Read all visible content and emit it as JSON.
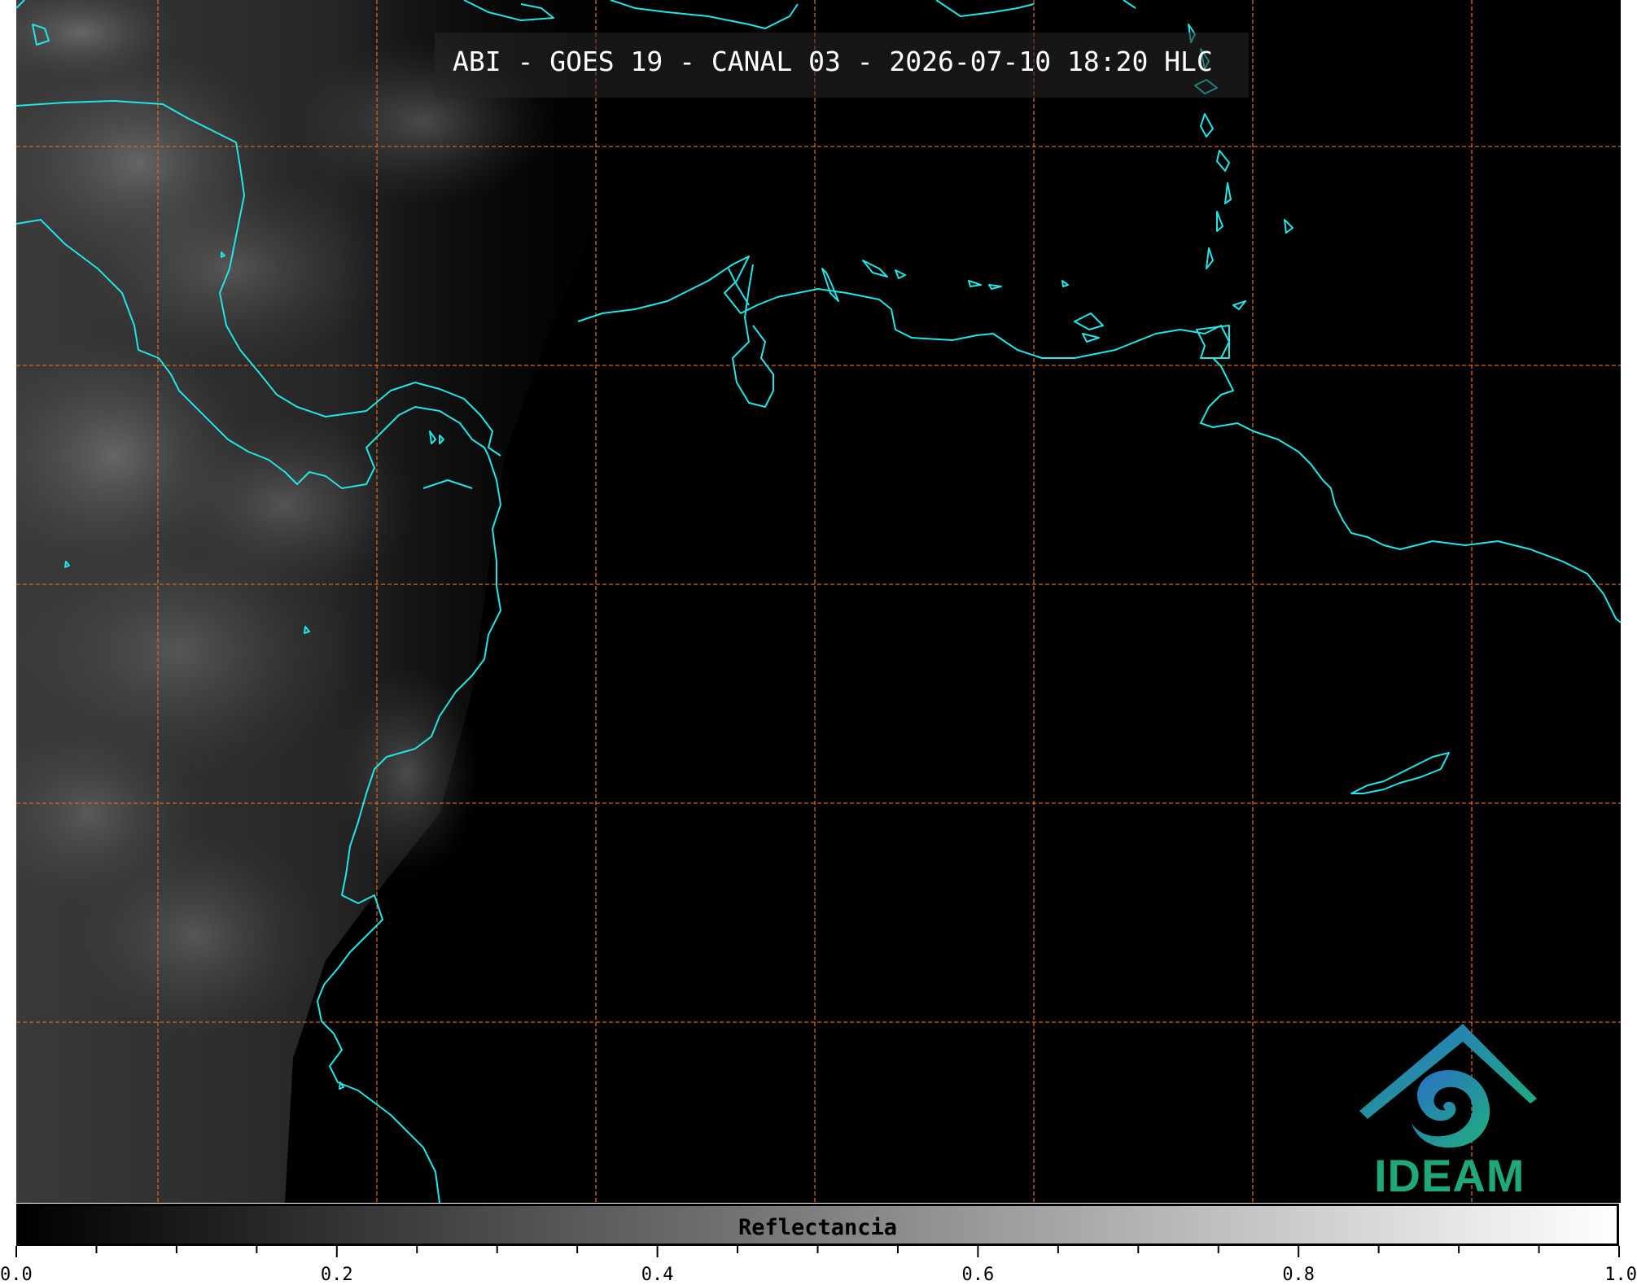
{
  "title": "ABI - GOES 19 - CANAL 03 - 2026-07-10 18:20 HLC",
  "logo": {
    "text": "IDEAM",
    "icon": "ideam-logo-icon"
  },
  "colorbar": {
    "label": "Reflectancia",
    "ticks": [
      "0.0",
      "0.2",
      "0.4",
      "0.6",
      "0.8",
      "1.0"
    ],
    "range": [
      0.0,
      1.0
    ],
    "colors": {
      "low": "#000000",
      "high": "#ffffff"
    }
  },
  "colors": {
    "coastline": "#22e5e5",
    "graticule": "#d2691e",
    "background": "#000000"
  }
}
